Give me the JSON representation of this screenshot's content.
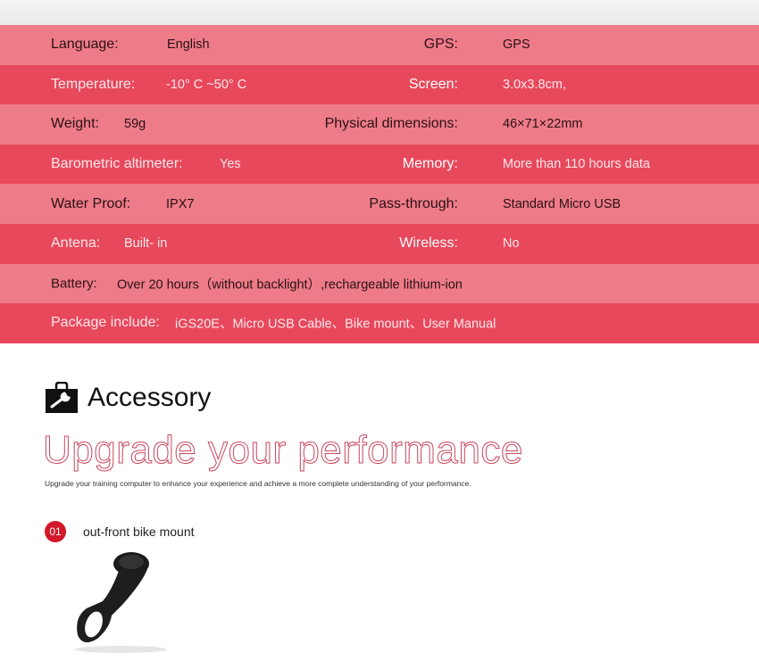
{
  "specs": [
    {
      "label": "Language:",
      "value": "English",
      "right_label": "GPS:",
      "right_value": "GPS"
    },
    {
      "label": "Temperature:",
      "value": "-10° C ~50° C",
      "right_label": "Screen:",
      "right_value": "3.0x3.8cm,"
    },
    {
      "label": "Weight:",
      "value": "59g",
      "right_label": "Physical dimensions:",
      "right_value": "46×71×22mm"
    },
    {
      "label": "Barometric altimeter:",
      "value": "Yes",
      "right_label": "Memory:",
      "right_value": "More than 110 hours data"
    },
    {
      "label": "Water Proof:",
      "value": "IPX7",
      "right_label": "Pass-through:",
      "right_value": "Standard Micro USB"
    },
    {
      "label": "Antena:",
      "value": "Built- in",
      "right_label": "Wireless:",
      "right_value": "No"
    },
    {
      "label": "Battery:",
      "value": "Over 20 hours（without backlight）,rechargeable lithium-ion"
    },
    {
      "label": "Package include:",
      "value": "iGS20E、Micro USB Cable、Bike mount、User Manual"
    }
  ],
  "accessory": {
    "icon": "toolbox-wrench-icon",
    "title": "Accessory",
    "headline": "Upgrade your performance",
    "subtitle": "Upgrade your training computer to enhance your experience and achieve a more complete understanding of your performance.",
    "items": [
      {
        "number": "01",
        "label": "out-front bike mount"
      }
    ]
  },
  "colors": {
    "light_row": "#ee7c88",
    "dark_row": "#e8485c",
    "badge": "#d2182a"
  }
}
